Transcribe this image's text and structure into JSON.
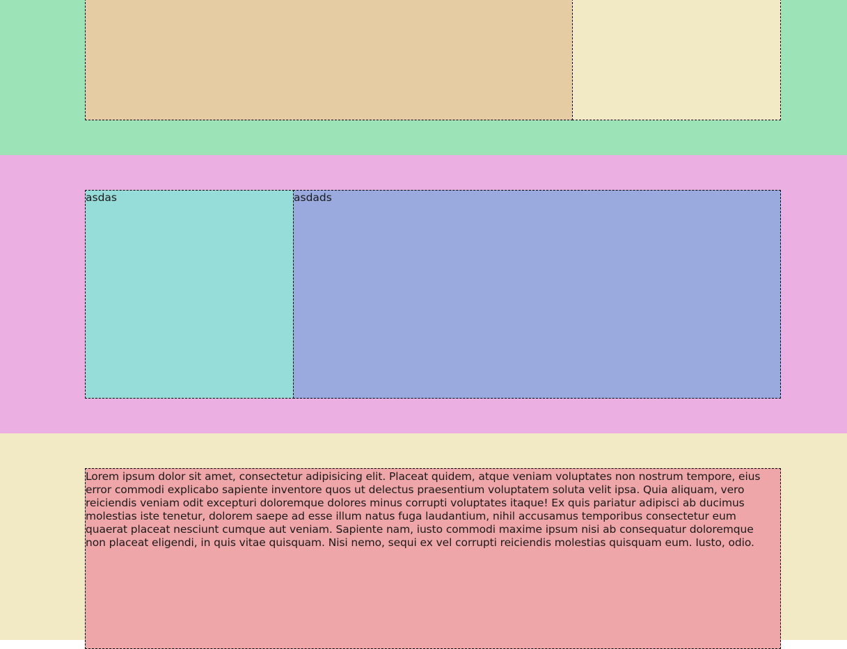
{
  "colors": {
    "top_band": "#9ce4b8",
    "top_left_box": "#e6cca2",
    "top_right_box": "#f2e9c5",
    "middle_band": "#ebafe2",
    "middle_left_box": "#96dcd9",
    "middle_right_box": "#9aaade",
    "bottom_band": "#f2e9c5",
    "bottom_box": "#efa6a8"
  },
  "middle": {
    "left_box_text": "asdas",
    "right_box_text": "asdads"
  },
  "bottom": {
    "paragraph": "Lorem ipsum dolor sit amet, consectetur adipisicing elit. Placeat quidem, atque veniam voluptates non nostrum tempore, eius error commodi explicabo sapiente inventore quos ut delectus praesentium voluptatem soluta velit ipsa. Quia aliquam, vero reiciendis veniam odit excepturi doloremque dolores minus corrupti voluptates itaque! Ex quis pariatur adipisci ab ducimus molestias iste tenetur, dolorem saepe ad esse illum natus fuga laudantium, nihil accusamus temporibus consectetur eum quaerat placeat nesciunt cumque aut veniam. Sapiente nam, iusto commodi maxime ipsum nisi ab consequatur doloremque non placeat eligendi, in quis vitae quisquam. Nisi nemo, sequi ex vel corrupti reiciendis molestias quisquam eum. Iusto, odio."
  }
}
